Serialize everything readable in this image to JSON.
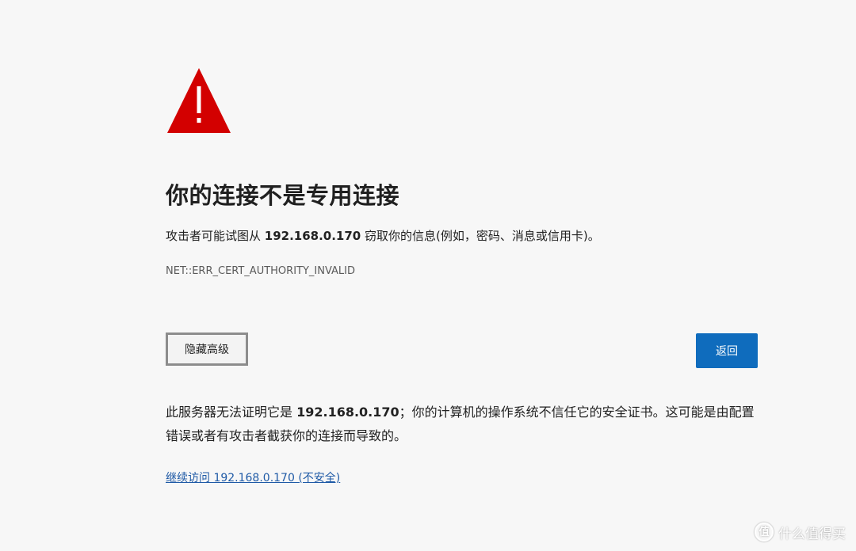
{
  "warning": {
    "icon": "warning-triangle-icon",
    "color": "#d30000"
  },
  "page": {
    "title": "你的连接不是专用连接",
    "intro_prefix": "攻击者可能试图从 ",
    "host": "192.168.0.170",
    "intro_suffix": " 窃取你的信息(例如，密码、消息或信用卡)。",
    "error_code": "NET::ERR_CERT_AUTHORITY_INVALID"
  },
  "buttons": {
    "hide_advanced": "隐藏高级",
    "back": "返回"
  },
  "details": {
    "prefix": "此服务器无法证明它是 ",
    "host": "192.168.0.170",
    "suffix": "；你的计算机的操作系统不信任它的安全证书。这可能是由配置错误或者有攻击者截获你的连接而导致的。"
  },
  "continue_link": "继续访问 192.168.0.170 (不安全)",
  "watermark": {
    "badge": "值",
    "text": "什么值得买"
  },
  "colors": {
    "background": "#f7f7f7",
    "accent_button": "#0f6cbd",
    "link": "#1f5aa6"
  }
}
